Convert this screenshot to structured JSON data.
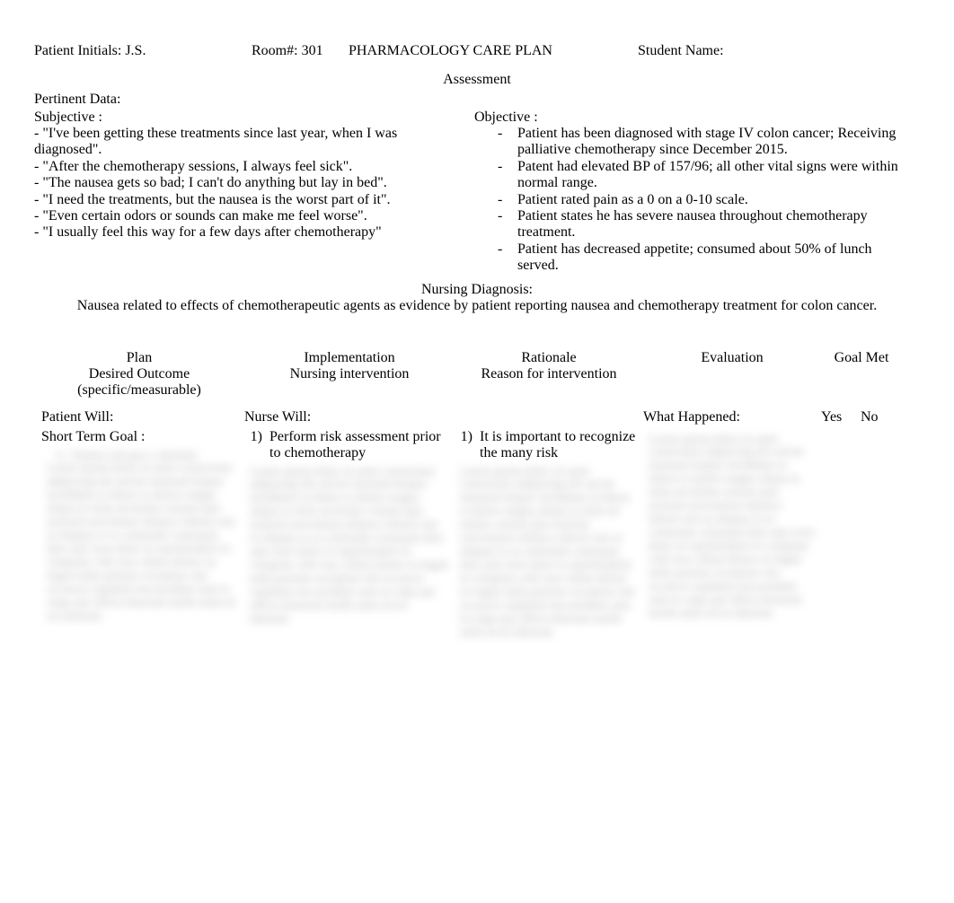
{
  "header": {
    "patient_initials_label": "Patient Initials: J.S.",
    "room_label": "Room#: 301",
    "title": "PHARMACOLOGY CARE PLAN",
    "student_label": "Student Name:"
  },
  "assessment": {
    "title": "Assessment",
    "pertinent_label": "Pertinent Data:",
    "subjective_label": "Subjective :",
    "subjective_lines": [
      "- \"I've been getting these treatments since last year, when I was diagnosed\".",
      "- \"After the chemotherapy sessions, I always feel sick\".",
      "- \"The nausea gets so bad; I can't do anything but lay in bed\".",
      "- \"I need the treatments, but the nausea is the worst part of it\".",
      "- \"Even certain odors or sounds can make me feel worse\".",
      "- \"I usually feel this way for a few days after chemotherapy\""
    ],
    "objective_label": "Objective :",
    "objective_items": [
      "Patient has been diagnosed with stage IV colon cancer; Receiving palliative chemotherapy since December 2015.",
      "Patent had elevated BP of 157/96; all other vital signs were within normal range.",
      "Patient rated pain as a 0 on a 0-10 scale.",
      "Patient states he has severe nausea throughout chemotherapy treatment.",
      "Patient has decreased appetite; consumed about 50% of lunch served."
    ]
  },
  "nursing_dx": {
    "title": "Nursing Diagnosis:",
    "body": "Nausea related to effects of chemotherapeutic agents as evidence by patient reporting nausea and chemotherapy treatment for colon cancer."
  },
  "columns": {
    "plan": "Plan",
    "plan_sub1": "Desired Outcome",
    "plan_sub2": "(specific/measurable)",
    "impl": "Implementation",
    "impl_sub": "Nursing intervention",
    "rat": "Rationale",
    "rat_sub": "Reason for intervention",
    "eval": "Evaluation",
    "goal": "Goal Met"
  },
  "row_labels": {
    "patient_will": "Patient Will:",
    "nurse_will": "Nurse Will:",
    "what_happened": "What Happened:",
    "yes": "Yes",
    "no": "No"
  },
  "body": {
    "short_term_label": "Short Term Goal   :",
    "plan_item1_num": "1)",
    "plan_item1_text": "Patient will give a detailed",
    "impl_item1_num": "1)",
    "impl_item1_text": "Perform risk assessment prior to chemotherapy",
    "rat_item1_num": "1)",
    "rat_item1_text": "It is important to recognize the many risk"
  },
  "blurred_filler": "Lorem ipsum dolor sit amet consectetur adipiscing elit sed do eiusmod tempor incididunt ut labore et dolore magna aliqua ut enim ad minim veniam quis nostrud exercitation ullamco laboris nisi ut aliquip ex ea commodo consequat duis aute irure dolor in reprehenderit in voluptate velit esse cillum dolore eu fugiat nulla pariatur excepteur sint occaecat cupidatat non proident sunt in culpa qui officia deserunt mollit anim id est laborum"
}
